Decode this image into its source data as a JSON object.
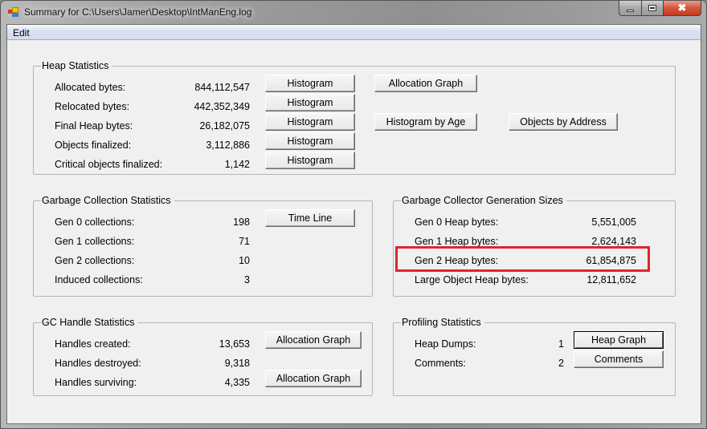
{
  "window": {
    "title": "Summary for C:\\Users\\Jamer\\Desktop\\IntManEng.log",
    "icon": "app-window-icon",
    "controls": {
      "minimize": "minimize-icon",
      "maximize": "maximize-icon",
      "close": "✖"
    }
  },
  "menu": {
    "items": [
      {
        "label": "Edit"
      }
    ]
  },
  "heap_statistics": {
    "title": "Heap Statistics",
    "rows": [
      {
        "label": "Allocated bytes:",
        "value": "844,112,547",
        "button": "Histogram"
      },
      {
        "label": "Relocated bytes:",
        "value": "442,352,349",
        "button": "Histogram"
      },
      {
        "label": "Final Heap bytes:",
        "value": "26,182,075",
        "button": "Histogram"
      },
      {
        "label": "Objects finalized:",
        "value": "3,112,886",
        "button": "Histogram"
      },
      {
        "label": "Critical objects finalized:",
        "value": "1,142",
        "button": "Histogram"
      }
    ],
    "allocation_graph_button": "Allocation Graph",
    "histogram_by_age_button": "Histogram by Age",
    "objects_by_address_button": "Objects by Address"
  },
  "gc_statistics": {
    "title": "Garbage Collection Statistics",
    "rows": [
      {
        "label": "Gen 0 collections:",
        "value": "198"
      },
      {
        "label": "Gen 1 collections:",
        "value": "71"
      },
      {
        "label": "Gen 2 collections:",
        "value": "10"
      },
      {
        "label": "Induced collections:",
        "value": "3"
      }
    ],
    "time_line_button": "Time Line"
  },
  "generation_sizes": {
    "title": "Garbage Collector Generation Sizes",
    "rows": [
      {
        "label": "Gen 0 Heap bytes:",
        "value": "5,551,005"
      },
      {
        "label": "Gen 1 Heap bytes:",
        "value": "2,624,143"
      },
      {
        "label": "Gen 2 Heap bytes:",
        "value": "61,854,875"
      },
      {
        "label": "Large Object Heap bytes:",
        "value": "12,811,652"
      }
    ],
    "highlight_color": "#e0242e"
  },
  "handle_statistics": {
    "title": "GC Handle Statistics",
    "rows": [
      {
        "label": "Handles created:",
        "value": "13,653"
      },
      {
        "label": "Handles destroyed:",
        "value": "9,318"
      },
      {
        "label": "Handles surviving:",
        "value": "4,335"
      }
    ],
    "created_button": "Allocation Graph",
    "surviving_button": "Allocation Graph"
  },
  "profiling_statistics": {
    "title": "Profiling Statistics",
    "rows": [
      {
        "label": "Heap Dumps:",
        "value": "1",
        "button": "Heap Graph"
      },
      {
        "label": "Comments:",
        "value": "2",
        "button": "Comments"
      }
    ]
  }
}
